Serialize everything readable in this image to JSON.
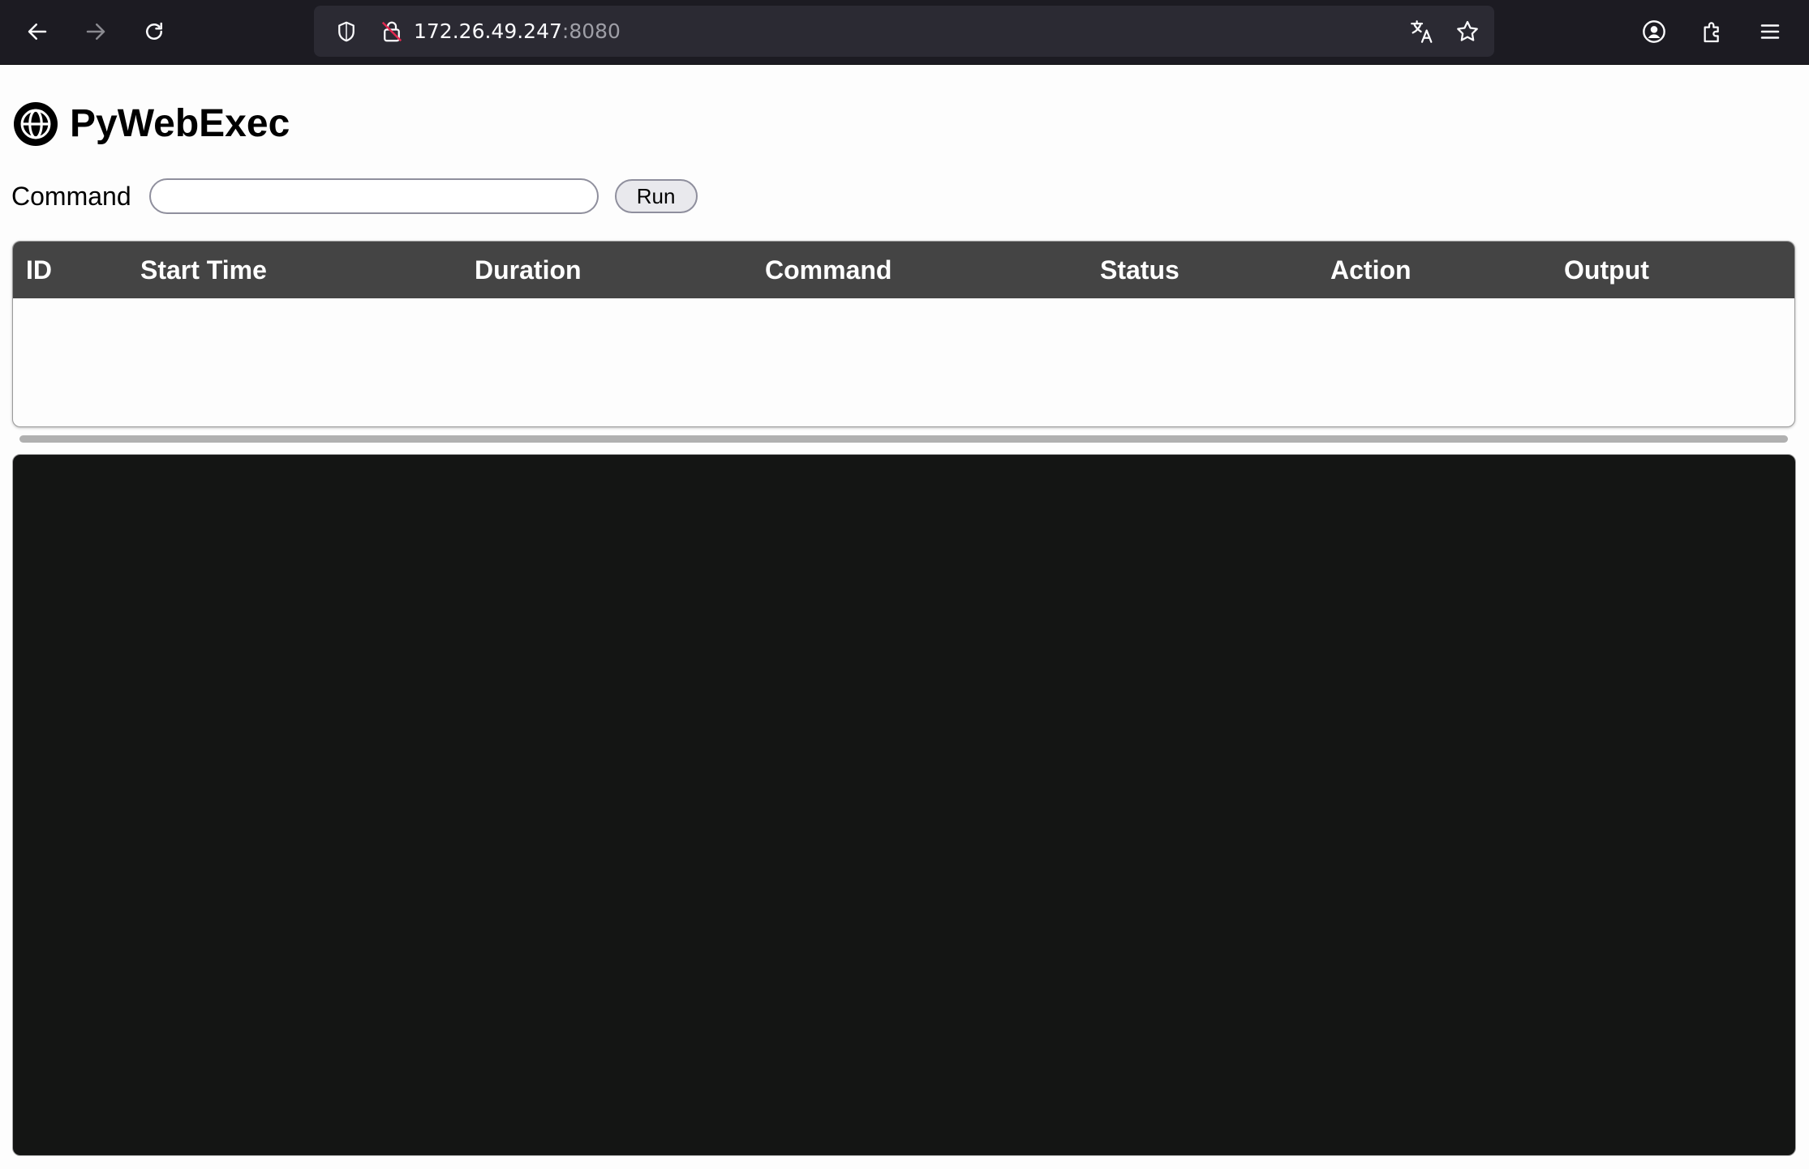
{
  "browser": {
    "url_host": "172.26.49.247",
    "url_port": ":8080",
    "icons": [
      "back-icon",
      "forward-icon",
      "reload-icon",
      "shield-icon",
      "insecure-lock-icon",
      "translate-icon",
      "bookmark-star-icon",
      "account-icon",
      "extensions-icon",
      "menu-icon"
    ]
  },
  "page": {
    "title": "PyWebExec",
    "logo_icon": "globe-icon",
    "command_label": "Command",
    "command_value": "",
    "run_label": "Run"
  },
  "table": {
    "headers": [
      "ID",
      "Start Time",
      "Duration",
      "Command",
      "Status",
      "Action",
      "Output"
    ],
    "rows": []
  },
  "colors": {
    "browser_bg": "#1c1b22",
    "urlbar_bg": "#2b2a33",
    "table_header_bg": "#444444",
    "terminal_bg": "#141514"
  }
}
